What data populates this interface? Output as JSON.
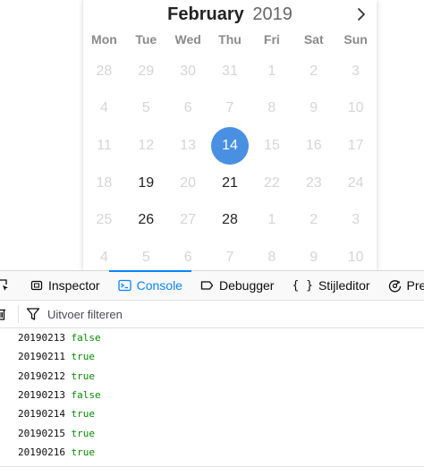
{
  "calendar": {
    "month": "February",
    "year": "2019",
    "next_icon": "chevron-right-icon",
    "weekdays": [
      "Mon",
      "Tue",
      "Wed",
      "Thu",
      "Fri",
      "Sat",
      "Sun"
    ],
    "days": [
      {
        "label": "28",
        "state": "disabled"
      },
      {
        "label": "29",
        "state": "disabled"
      },
      {
        "label": "30",
        "state": "disabled"
      },
      {
        "label": "31",
        "state": "disabled"
      },
      {
        "label": "1",
        "state": "disabled"
      },
      {
        "label": "2",
        "state": "disabled"
      },
      {
        "label": "3",
        "state": "disabled"
      },
      {
        "label": "4",
        "state": "disabled"
      },
      {
        "label": "5",
        "state": "disabled"
      },
      {
        "label": "6",
        "state": "disabled"
      },
      {
        "label": "7",
        "state": "disabled"
      },
      {
        "label": "8",
        "state": "disabled"
      },
      {
        "label": "9",
        "state": "disabled"
      },
      {
        "label": "10",
        "state": "disabled"
      },
      {
        "label": "11",
        "state": "disabled"
      },
      {
        "label": "12",
        "state": "disabled"
      },
      {
        "label": "13",
        "state": "disabled"
      },
      {
        "label": "14",
        "state": "selected"
      },
      {
        "label": "15",
        "state": "disabled"
      },
      {
        "label": "16",
        "state": "disabled"
      },
      {
        "label": "17",
        "state": "disabled"
      },
      {
        "label": "18",
        "state": "disabled"
      },
      {
        "label": "19",
        "state": "enabled"
      },
      {
        "label": "20",
        "state": "disabled"
      },
      {
        "label": "21",
        "state": "enabled"
      },
      {
        "label": "22",
        "state": "disabled"
      },
      {
        "label": "23",
        "state": "disabled"
      },
      {
        "label": "24",
        "state": "disabled"
      },
      {
        "label": "25",
        "state": "disabled"
      },
      {
        "label": "26",
        "state": "enabled"
      },
      {
        "label": "27",
        "state": "disabled"
      },
      {
        "label": "28",
        "state": "enabled"
      },
      {
        "label": "1",
        "state": "disabled"
      },
      {
        "label": "2",
        "state": "disabled"
      },
      {
        "label": "3",
        "state": "disabled"
      },
      {
        "label": "4",
        "state": "disabled"
      },
      {
        "label": "5",
        "state": "disabled"
      },
      {
        "label": "6",
        "state": "disabled"
      },
      {
        "label": "7",
        "state": "disabled"
      },
      {
        "label": "8",
        "state": "disabled"
      },
      {
        "label": "9",
        "state": "disabled"
      },
      {
        "label": "10",
        "state": "disabled"
      }
    ],
    "selected_color": "#4a90e2"
  },
  "devtools": {
    "tabs": [
      {
        "label": "Inspector",
        "icon": "inspector-icon",
        "selected": false
      },
      {
        "label": "Console",
        "icon": "console-icon",
        "selected": true
      },
      {
        "label": "Debugger",
        "icon": "debugger-icon",
        "selected": false
      },
      {
        "label": "Stijleditor",
        "icon": "braces-icon",
        "selected": false
      },
      {
        "label": "Prestaties",
        "icon": "performance-icon",
        "selected": false
      }
    ],
    "accent_color": "#0a84ff",
    "filter_placeholder": "Uitvoer filteren",
    "logs": [
      {
        "date": "20190213",
        "value": "false"
      },
      {
        "date": "20190211",
        "value": "true"
      },
      {
        "date": "20190212",
        "value": "true"
      },
      {
        "date": "20190213",
        "value": "false"
      },
      {
        "date": "20190214",
        "value": "true"
      },
      {
        "date": "20190215",
        "value": "true"
      },
      {
        "date": "20190216",
        "value": "true"
      }
    ],
    "bool_color": "#058b00"
  }
}
